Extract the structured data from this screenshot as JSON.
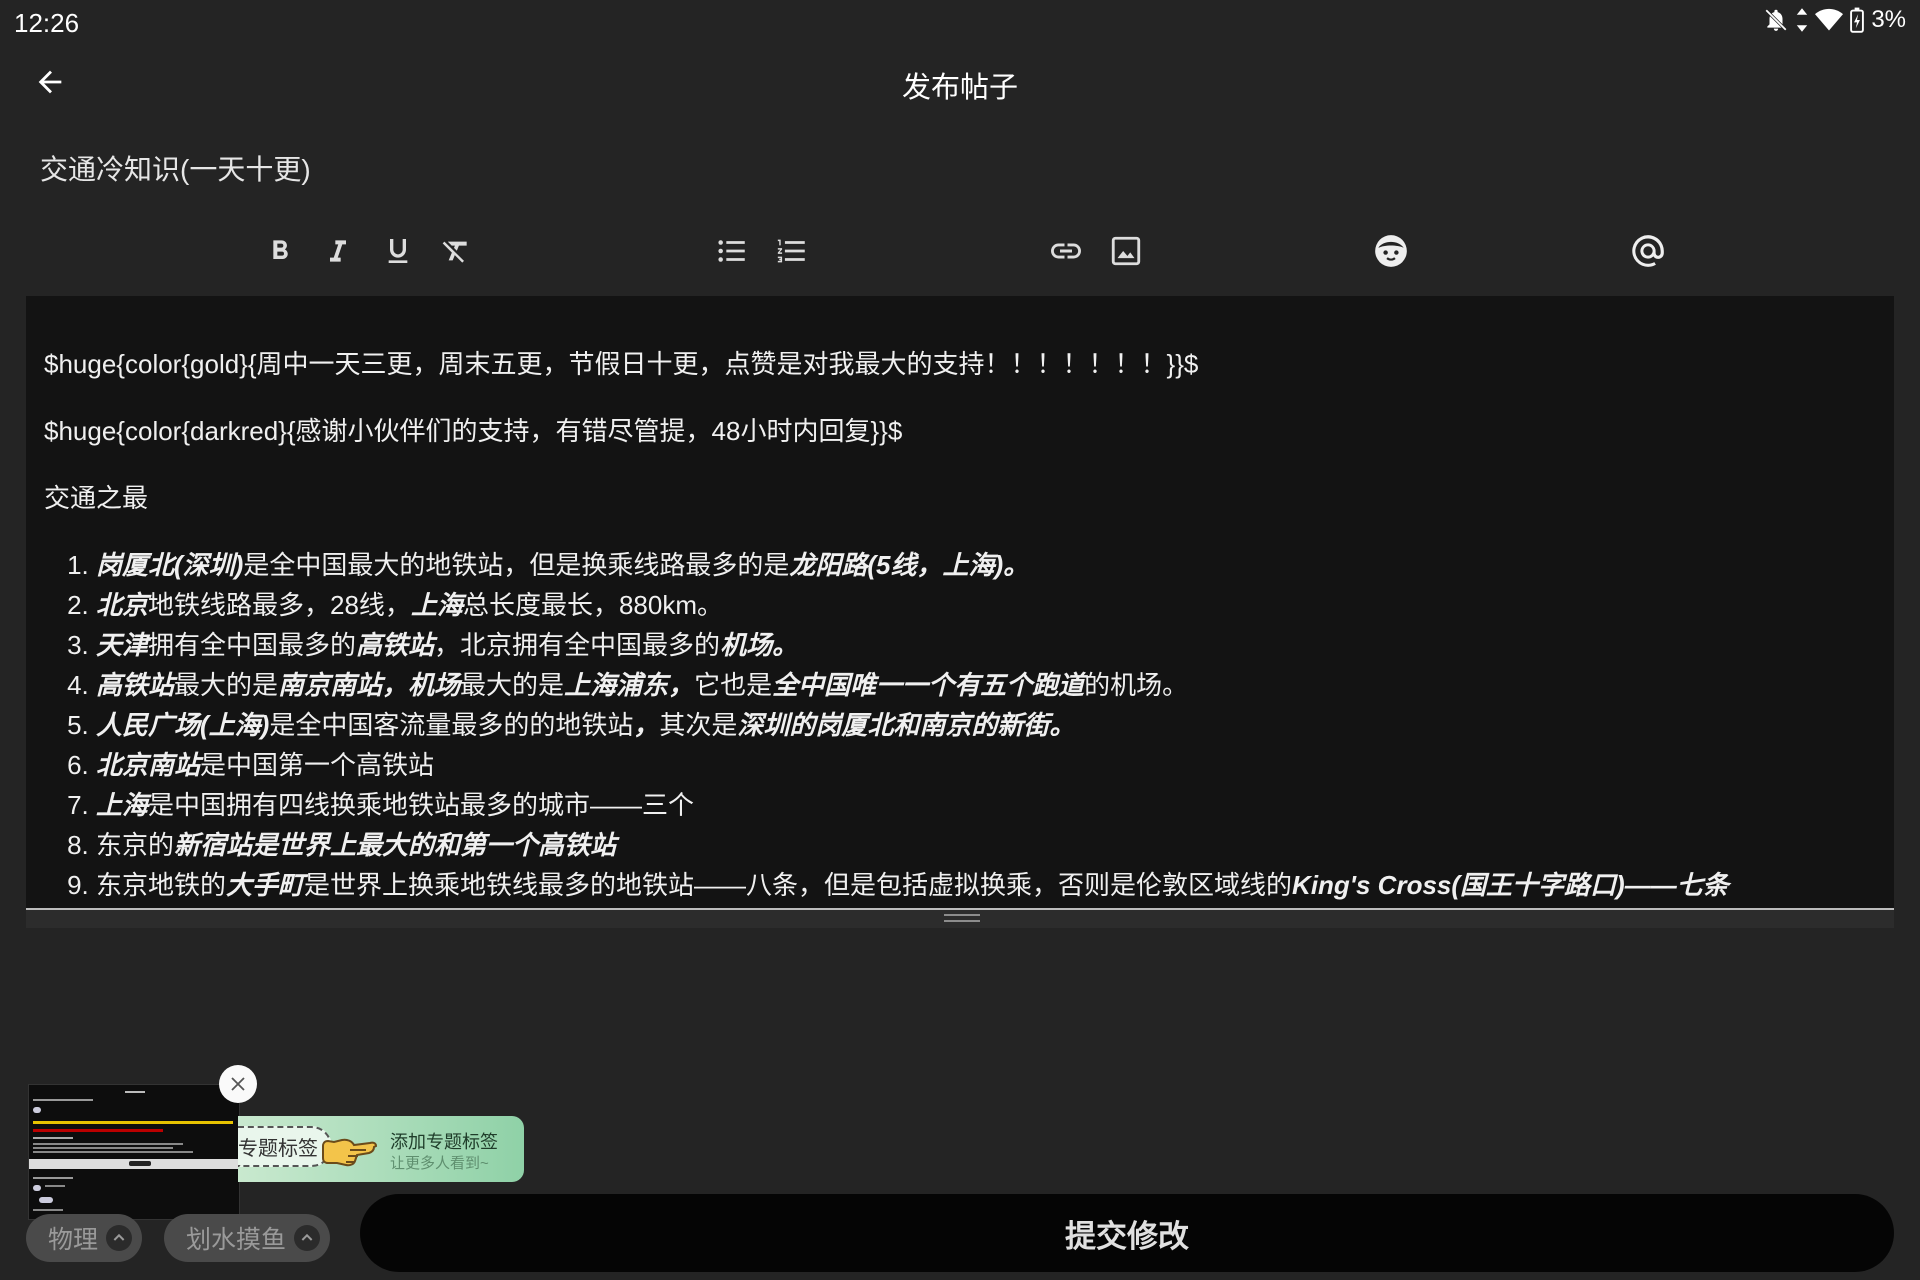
{
  "status_bar": {
    "time": "12:26",
    "battery": "3%",
    "icons": [
      "bell-off-icon",
      "data-arrows-icon",
      "wifi-icon",
      "battery-charging-icon"
    ]
  },
  "app_bar": {
    "title": "发布帖子",
    "back_icon": "arrow-left-icon"
  },
  "post_title": "交通冷知识(一天十更)",
  "toolbar": {
    "icons": [
      "bold-icon",
      "italic-icon",
      "underline-icon",
      "clear-format-icon",
      "bullet-list-icon",
      "numbered-list-icon",
      "link-icon",
      "image-icon",
      "emoji-icon",
      "mention-icon"
    ]
  },
  "editor": {
    "paragraphs": [
      "$huge{color{gold}{周中一天三更，周末五更，节假日十更，点赞是对我最大的支持！！！！！！！}}$",
      "$huge{color{darkred}{感谢小伙伴们的支持，有错尽管提，48小时内回复}}$",
      "交通之最"
    ],
    "list": [
      [
        {
          "t": "岗厦北(深圳)",
          "b": true
        },
        {
          "t": "是全中国最大的地铁站，但是换乘线路最多的是"
        },
        {
          "t": "龙阳路(5线，上海)。",
          "b": true
        }
      ],
      [
        {
          "t": "北京",
          "b": true
        },
        {
          "t": "地铁线路最多，28线，"
        },
        {
          "t": "上海",
          "b": true
        },
        {
          "t": "总长度最长，880km。"
        }
      ],
      [
        {
          "t": "天津",
          "b": true
        },
        {
          "t": "拥有全中国最多的"
        },
        {
          "t": "高铁站",
          "b": true
        },
        {
          "t": "，北京拥有全中国最多的"
        },
        {
          "t": "机场。",
          "b": true
        }
      ],
      [
        {
          "t": "高铁站",
          "b": true
        },
        {
          "t": "最大的是"
        },
        {
          "t": "南京南站，机场",
          "b": true
        },
        {
          "t": "最大的是"
        },
        {
          "t": "上海浦东，",
          "b": true
        },
        {
          "t": "它也是"
        },
        {
          "t": "全中国唯一一个有五个跑道",
          "b": true
        },
        {
          "t": "的机场。"
        }
      ],
      [
        {
          "t": "人民广场(上海)",
          "b": true
        },
        {
          "t": "是全中国客流量最多的的地铁站"
        },
        {
          "t": "，",
          "b": true
        },
        {
          "t": "其次是"
        },
        {
          "t": "深圳的岗厦北和南京的新街。",
          "b": true
        }
      ],
      [
        {
          "t": "北京南站",
          "b": true
        },
        {
          "t": "是中国第一个高铁站"
        }
      ],
      [
        {
          "t": "上海",
          "b": true
        },
        {
          "t": "是中国拥有四线换乘地铁站最多的城市——三个"
        }
      ],
      [
        {
          "t": "东京的"
        },
        {
          "t": "新宿站是世界上最大的和第一个高铁站",
          "b": true
        }
      ],
      [
        {
          "t": "东京地铁的"
        },
        {
          "t": "大手町",
          "b": true
        },
        {
          "t": "是世界上换乘地铁线最多的地铁站——八条，但是包括虚拟换乘，否则是伦敦区域线的"
        },
        {
          "t": "King's Cross(国王十字路口)——七条",
          "b": true
        }
      ]
    ]
  },
  "topic_banner": {
    "chip_label": "专题标签",
    "title": "添加专题标签",
    "subtitle": "让更多人看到~"
  },
  "tags": [
    {
      "label": "物理"
    },
    {
      "label": "划水摸鱼"
    }
  ],
  "submit_label": "提交修改"
}
